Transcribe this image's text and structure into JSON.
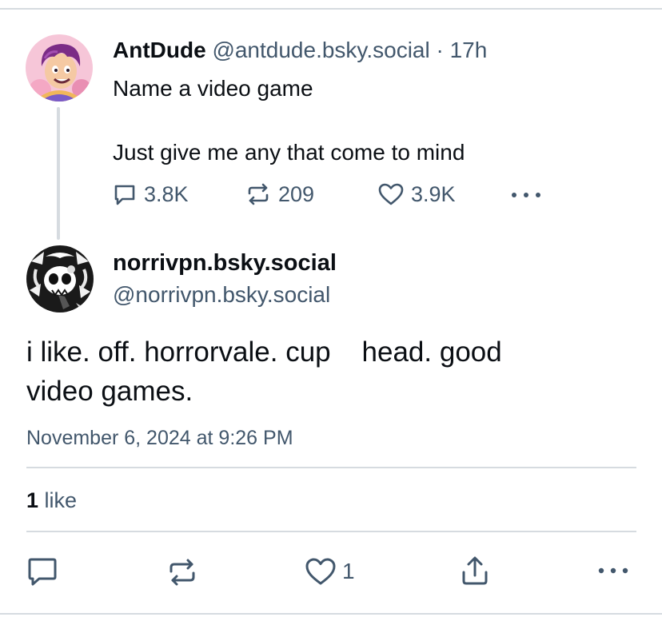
{
  "parent_post": {
    "author_name": "AntDude",
    "handle": "@antdude.bsky.social",
    "separator": "·",
    "time": "17h",
    "text_line1": "Name a video game",
    "text_line2": "Just give me any that come to mind",
    "replies": "3.8K",
    "reposts": "209",
    "likes": "3.9K"
  },
  "main_post": {
    "author_name": "norrivpn.bsky.social",
    "handle": "@norrivpn.bsky.social",
    "text_line1": "i like. off. horrorvale. cup    head. good",
    "text_line2": "video games.",
    "timestamp": "November 6, 2024 at 9:26 PM",
    "like_count": "1",
    "like_label": " like",
    "action_like_count": "1"
  },
  "icons": {
    "reply": "speech-bubble-icon",
    "repost": "repost-arrows-icon",
    "like": "heart-icon",
    "share": "share-upload-icon",
    "more": "ellipsis-icon"
  },
  "colors": {
    "text": "#0b0f14",
    "muted": "#42576c",
    "divider": "#d6dbe0",
    "thread_line": "#d6dbe0"
  }
}
